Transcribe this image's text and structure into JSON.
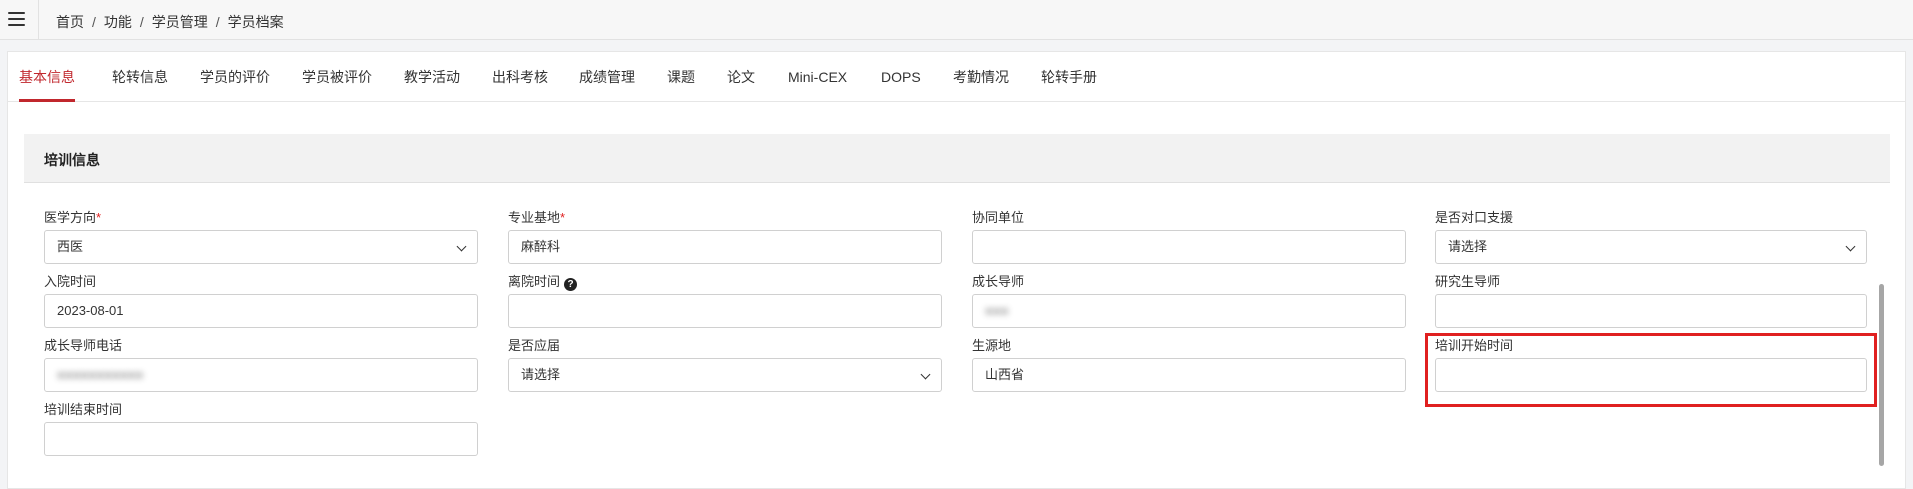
{
  "breadcrumb": [
    "首页",
    "功能",
    "学员管理",
    "学员档案"
  ],
  "tabs": [
    "基本信息",
    "轮转信息",
    "学员的评价",
    "学员被评价",
    "教学活动",
    "出科考核",
    "成绩管理",
    "课题",
    "论文",
    "Mini-CEX",
    "DOPS",
    "考勤情况",
    "轮转手册"
  ],
  "active_tab": "基本信息",
  "section": {
    "title": "培训信息"
  },
  "fields": {
    "medical_direction": {
      "label": "医学方向",
      "required": "*",
      "value": "西医"
    },
    "specialty_base": {
      "label": "专业基地",
      "required": "*",
      "value": "麻醉科"
    },
    "collab_unit": {
      "label": "协同单位",
      "value": ""
    },
    "counterpart_support": {
      "label": "是否对口支援",
      "value": "请选择"
    },
    "admission_date": {
      "label": "入院时间",
      "value": "2023-08-01"
    },
    "leave_date": {
      "label": "离院时间",
      "value": ""
    },
    "mentor": {
      "label": "成长导师",
      "value": "●●●"
    },
    "grad_mentor": {
      "label": "研究生导师",
      "value": ""
    },
    "mentor_phone": {
      "label": "成长导师电话",
      "value": "●●●●●●●●●●●"
    },
    "fresh_graduate": {
      "label": "是否应届",
      "value": "请选择"
    },
    "origin": {
      "label": "生源地",
      "value": "山西省"
    },
    "training_start": {
      "label": "培训开始时间",
      "value": ""
    },
    "training_end": {
      "label": "培训结束时间",
      "value": ""
    }
  },
  "colors": {
    "accent": "#c1272d",
    "highlight_box": "#e02020"
  }
}
